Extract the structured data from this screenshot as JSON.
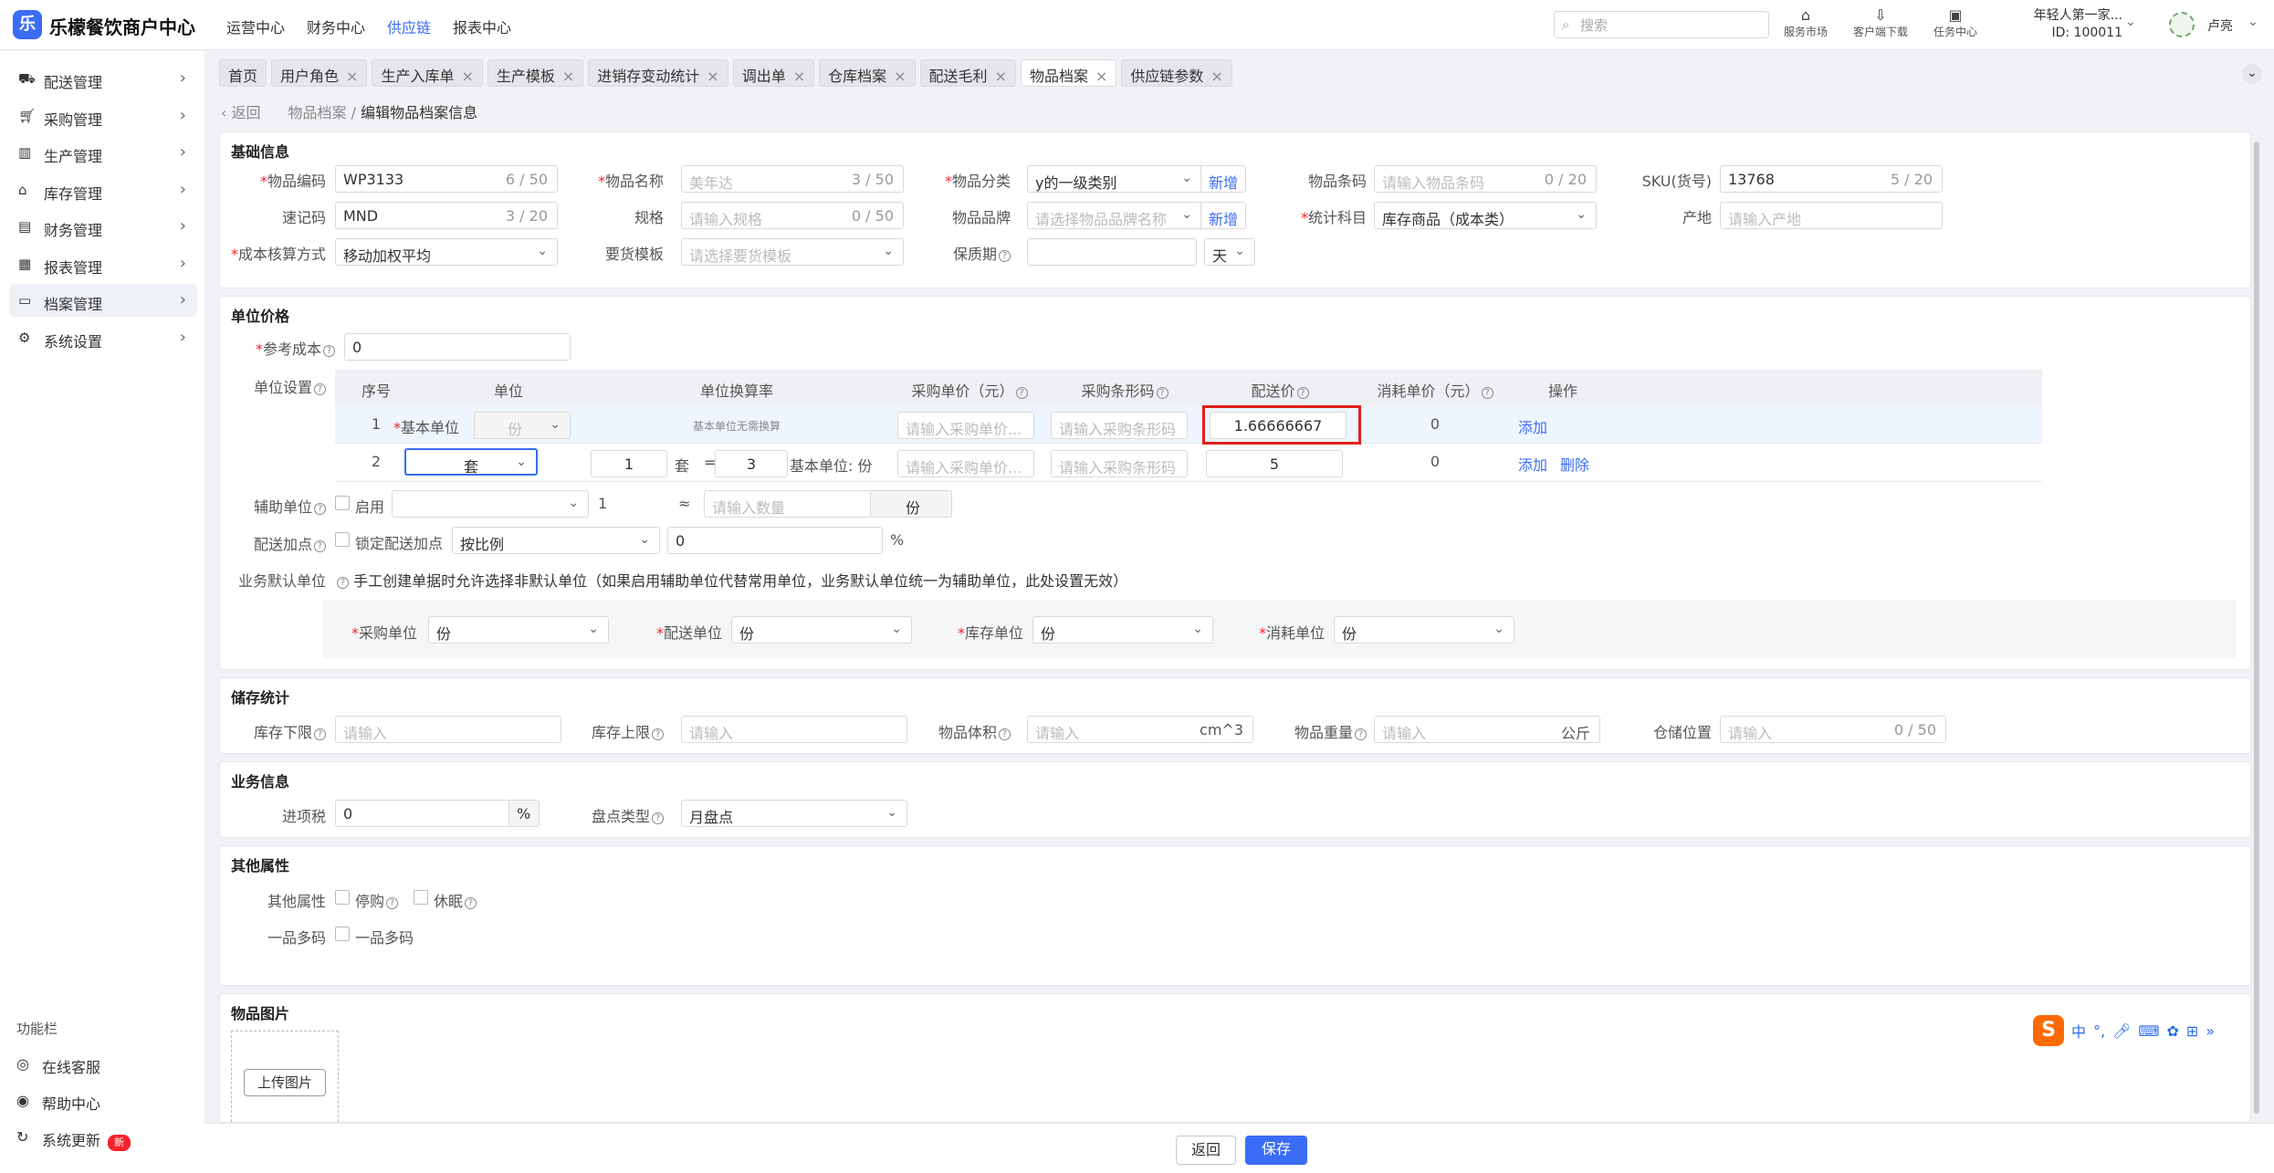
{
  "header": {
    "brand": "乐檬餐饮商户中心",
    "logo": "乐",
    "nav": [
      "运营中心",
      "财务中心",
      "供应链",
      "报表中心"
    ],
    "nav_active": "供应链",
    "search_placeholder": "搜索",
    "tools": [
      "服务市场",
      "客户端下载",
      "任务中心"
    ],
    "user_company": "年轻人第一家...",
    "user_id": "ID: 100011",
    "user_name": "卢亮"
  },
  "sidebar": {
    "items": [
      "配送管理",
      "采购管理",
      "生产管理",
      "库存管理",
      "财务管理",
      "报表管理",
      "档案管理",
      "系统设置"
    ],
    "active": "档案管理",
    "footer_title": "功能栏",
    "footer": [
      "在线客服",
      "帮助中心",
      "系统更新"
    ],
    "new_badge": "新"
  },
  "tabs": [
    "首页",
    "用户角色",
    "生产入库单",
    "生产模板",
    "进销存变动统计",
    "调出单",
    "仓库档案",
    "配送毛利",
    "物品档案",
    "供应链参数"
  ],
  "tabs_active": "物品档案",
  "breadcrumb": {
    "back": "返回",
    "parent": "物品档案",
    "sep": "/",
    "current": "编辑物品档案信息"
  },
  "basic": {
    "title": "基础信息",
    "code_label": "物品编码",
    "code": "WP3133",
    "code_count": "6 / 50",
    "name_label": "物品名称",
    "name_value": "美年达",
    "name_count": "3 / 50",
    "cat_label": "物品分类",
    "cat": "y的一级类别",
    "cat_add": "新增",
    "barcode_label": "物品条码",
    "barcode_ph": "请输入物品条码",
    "barcode_count": "0 / 20",
    "sku_label": "SKU(货号)",
    "sku": "13768",
    "sku_count": "5 / 20",
    "quick_label": "速记码",
    "quick": "MND",
    "quick_count": "3 / 20",
    "spec_label": "规格",
    "spec_ph": "请输入规格",
    "spec_count": "0 / 50",
    "brand_label": "物品品牌",
    "brand_ph": "请选择物品品牌名称",
    "brand_add": "新增",
    "acct_label": "统计科目",
    "acct": "库存商品（成本类）",
    "origin_label": "产地",
    "origin_ph": "请输入产地",
    "cost_label": "成本核算方式",
    "cost": "移动加权平均",
    "tpl_label": "要货模板",
    "tpl_ph": "请选择要货模板",
    "shelf_label": "保质期",
    "shelf_unit": "天"
  },
  "price": {
    "title": "单位价格",
    "ref_label": "参考成本",
    "ref": "0",
    "unit_set_label": "单位设置",
    "headers": [
      "序号",
      "单位",
      "单位换算率",
      "采购单价（元）",
      "采购条形码",
      "配送价",
      "消耗单价（元）",
      "操作"
    ],
    "row1": {
      "no": "1",
      "unit_label": "基本单位",
      "unit": "份",
      "rate": "基本单位无需换算",
      "buy_ph": "请输入采购单价...",
      "barcode_ph": "请输入采购条形码",
      "deliver": "1.66666667",
      "consume": "0",
      "add": "添加"
    },
    "row2": {
      "no": "2",
      "unit": "套",
      "qty": "1",
      "qty_unit": "套",
      "eq": "=",
      "rate": "3",
      "base": "基本单位: 份",
      "buy_ph": "请输入采购单价...",
      "barcode_ph": "请输入采购条形码",
      "deliver": "5",
      "consume": "0",
      "add": "添加",
      "del": "删除"
    },
    "aux_label": "辅助单位",
    "aux_enable": "启用",
    "aux_qty": "1",
    "aux_approx": "≈",
    "aux_ph": "请输入数量",
    "aux_unit": "份",
    "markup_label": "配送加点",
    "markup_lock": "锁定配送加点",
    "markup_mode": "按比例",
    "markup": "0",
    "pct": "%",
    "default_label": "业务默认单位",
    "default_note": "手工创建单据时允许选择非默认单位（如果启用辅助单位代替常用单位，业务默认单位统一为辅助单位，此处设置无效）",
    "buy_unit_label": "采购单位",
    "buy_unit": "份",
    "del_unit_label": "配送单位",
    "del_unit": "份",
    "stock_unit_label": "库存单位",
    "stock_unit": "份",
    "use_unit_label": "消耗单位",
    "use_unit": "份"
  },
  "storage": {
    "title": "储存统计",
    "min_label": "库存下限",
    "min_ph": "请输入",
    "max_label": "库存上限",
    "max_ph": "请输入",
    "vol_label": "物品体积",
    "vol_ph": "请输入",
    "vol_unit": "cm^3",
    "wt_label": "物品重量",
    "wt_ph": "请输入",
    "wt_unit": "公斤",
    "loc_label": "仓储位置",
    "loc_ph": "请输入",
    "loc_count": "0 / 50"
  },
  "biz": {
    "title": "业务信息",
    "tax_label": "进项税",
    "tax": "0",
    "tax_unit": "%",
    "count_label": "盘点类型",
    "count": "月盘点"
  },
  "other": {
    "title": "其他属性",
    "attr_label": "其他属性",
    "stop": "停购",
    "sleep": "休眠",
    "multi_label": "一品多码",
    "multi": "一品多码"
  },
  "image": {
    "title": "物品图片",
    "upload": "上传图片"
  },
  "footer": {
    "back": "返回",
    "save": "保存"
  },
  "ime": {
    "lang": "中",
    "punct": "°,"
  }
}
